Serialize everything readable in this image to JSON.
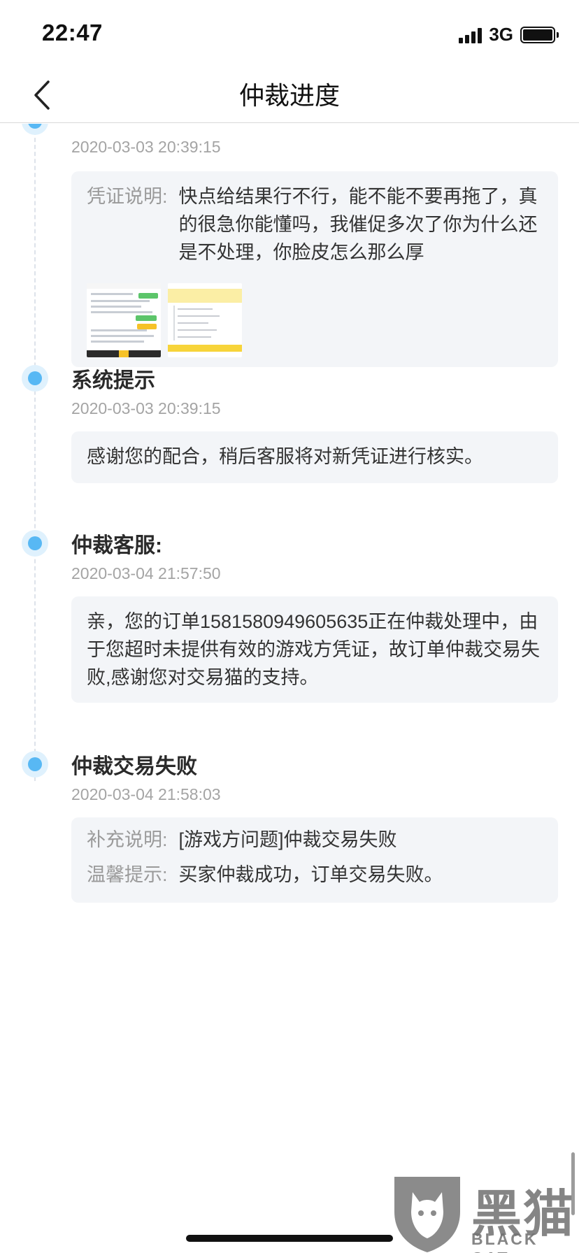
{
  "status_bar": {
    "time": "22:47",
    "network": "3G"
  },
  "nav": {
    "title": "仲裁进度",
    "back_icon": "chevron-left-icon"
  },
  "colors": {
    "timeline_dot": "#58b8f4",
    "card_bg": "#f3f5f8",
    "time_text": "#a4a4a4"
  },
  "entries": [
    {
      "time": "2020-03-03 20:39:15",
      "label": "凭证说明:",
      "text": "快点给结果行不行，能不能不要再拖了，真的很急你能懂吗，我催促多次了你为什么还是不处理，你脸皮怎么那么厚",
      "attachments": [
        "screenshot-chat",
        "screenshot-order"
      ]
    },
    {
      "title": "系统提示",
      "time": "2020-03-03 20:39:15",
      "text": "感谢您的配合，稍后客服将对新凭证进行核实。"
    },
    {
      "title": "仲裁客服:",
      "time": "2020-03-04 21:57:50",
      "text": "亲，您的订单1581580949605635正在仲裁处理中，由于您超时未提供有效的游戏方凭证，故订单仲裁交易失败,感谢您对交易猫的支持。"
    },
    {
      "title": "仲裁交易失败",
      "time": "2020-03-04 21:58:03",
      "fields": [
        {
          "label": "补充说明:",
          "value": "[游戏方问题]仲裁交易失败"
        },
        {
          "label": "温馨提示:",
          "value": "买家仲裁成功，订单交易失败。"
        }
      ]
    }
  ],
  "watermark": {
    "text": "黑猫",
    "sub": "BLACK CAT"
  }
}
